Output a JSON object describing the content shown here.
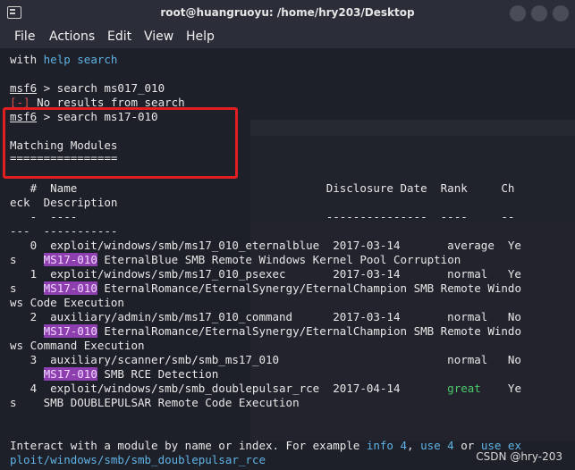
{
  "window": {
    "title": "root@huangruoyu: /home/hry203/Desktop"
  },
  "menu": [
    "File",
    "Actions",
    "Edit",
    "View",
    "Help"
  ],
  "terminal": {
    "l1_pre": "with ",
    "l1_a": "help",
    "l1_b": " ",
    "l1_c": "search",
    "p1_prompt": "msf6",
    "p1_cmd": " > search ms017_010",
    "err_mark": "[-]",
    "err_text": " No results from search",
    "p2_prompt": "msf6",
    "p2_cmd": " > search ms17-010",
    "heading": "Matching Modules",
    "heading_rule": "================",
    "col_line": "   #  Name                                     Disclosure Date  Rank     Ch",
    "col_line2": "eck  Description",
    "sep1": "   -  ----                                     ---------------  ----     --",
    "sep2": "---  -----------",
    "r0": "   0  exploit/windows/smb/ms17_010_eternalblue  2017-03-14       average  Ye",
    "r0b_pre": "s    ",
    "r0b_tag": "MS17-010",
    "r0b_txt": " EternalBlue SMB Remote Windows Kernel Pool Corruption",
    "r1": "   1  exploit/windows/smb/ms17_010_psexec       2017-03-14       normal   Ye",
    "r1b_pre": "s    ",
    "r1b_tag": "MS17-010",
    "r1b_txt": " EternalRomance/EternalSynergy/EternalChampion SMB Remote Windo",
    "r1c": "ws Code Execution",
    "r2": "   2  auxiliary/admin/smb/ms17_010_command      2017-03-14       normal   No",
    "r2b_pre": "     ",
    "r2b_tag": "MS17-010",
    "r2b_txt": " EternalRomance/EternalSynergy/EternalChampion SMB Remote Windo",
    "r2c": "ws Command Execution",
    "r3": "   3  auxiliary/scanner/smb/smb_ms17_010                         normal   No",
    "r3b_pre": "     ",
    "r3b_tag": "MS17-010",
    "r3b_txt": " SMB RCE Detection",
    "r4": "   4  exploit/windows/smb/smb_doublepulsar_rce  2017-04-14       ",
    "r4_rank": "great",
    "r4_end": "    Ye",
    "r4b": "s    SMB DOUBLEPULSAR Remote Code Execution",
    "f1_pre": "Interact with a module by name or index. For example ",
    "f1_a": "info 4",
    "f1_b": ", ",
    "f1_c": "use 4",
    "f1_d": " or ",
    "f1_e": "use ex",
    "f2": "ploit/windows/smb/smb_doublepulsar_rce"
  },
  "watermark": "CSDN @hry-203"
}
